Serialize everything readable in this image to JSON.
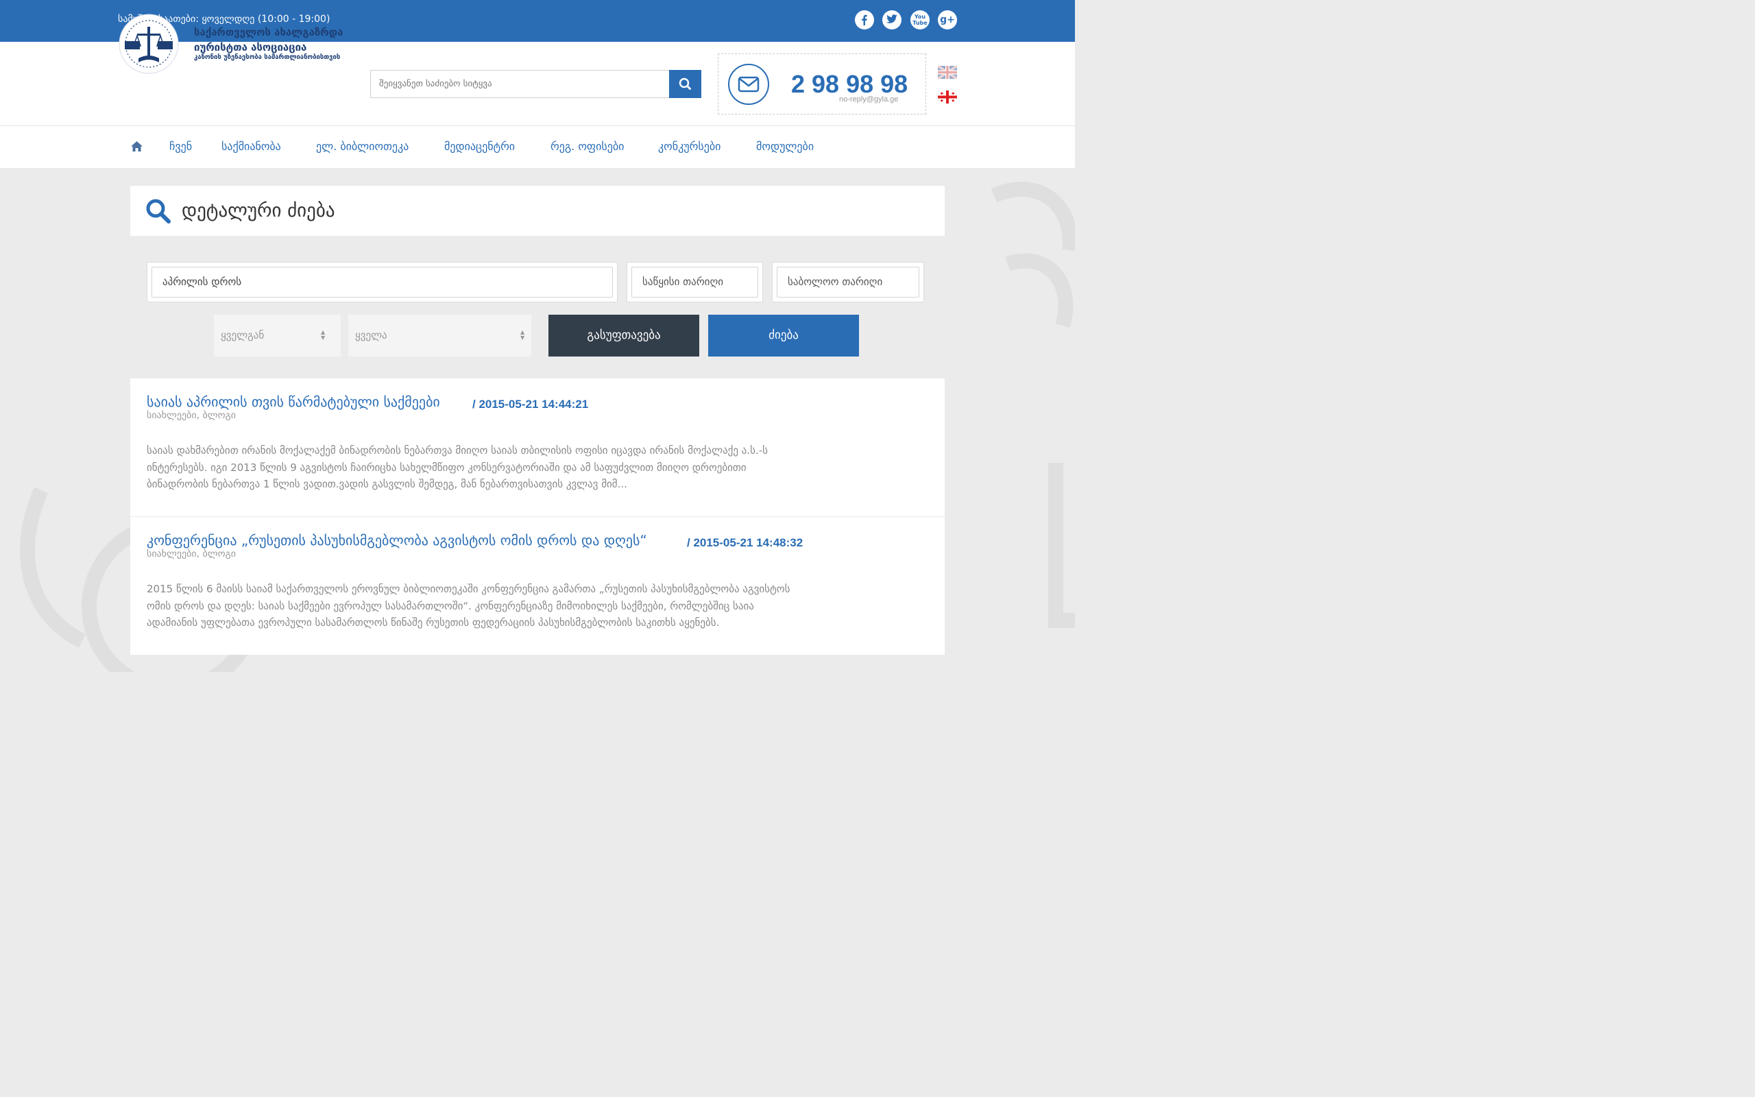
{
  "topbar": {
    "hours": "სამუშაო საათები: ყოველდღე (10:00 - 19:00)",
    "social": [
      {
        "name": "facebook-icon",
        "glyph": "f"
      },
      {
        "name": "twitter-icon",
        "glyph": ""
      },
      {
        "name": "youtube-icon",
        "glyph": "You"
      },
      {
        "name": "google-plus-icon",
        "glyph": "g+"
      }
    ]
  },
  "header": {
    "org_name_line1": "საქართველოს ახალგაზრდა",
    "org_name_line2": "იურისტთა ასოციაცია",
    "org_tagline": "კანონის უზენაესობა სამართლიანობისთვის",
    "search_placeholder": "შეიყვანეთ საძიებო სიტყვა",
    "phone": "2 98 98 98",
    "email": "no-reply@gyla.ge"
  },
  "nav": {
    "items": [
      "ჩვენ",
      "საქმიანობა",
      "ელ. ბიბლიოთეკა",
      "მედიაცენტრი",
      "რეგ. ოფისები",
      "კონკურსები",
      "მოდულები"
    ]
  },
  "search": {
    "title": "დეტალური ძიება",
    "query_value": "აპრილის დროს",
    "start_date_placeholder": "საწყისი თარიღი",
    "end_date_placeholder": "საბოლოო თარიღი",
    "source_select": "ყველგან",
    "category_select": "ყველა",
    "clear_button": "გასუფთავება",
    "search_button": "ძიება"
  },
  "results": [
    {
      "title": "საიას აპრილის თვის წარმატებული საქმეები",
      "date": "/ 2015-05-21 14:44:21",
      "categories": "სიახლეები, ბლოგი",
      "lines": [
        "საიას დახმარებით ირანის მოქალაქემ ბინადრობის ნებართვა მიიღო საიას თბილისის ოფისი იცავდა ირანის მოქალაქე ა.ს.-ს",
        "ინტერესებს. იგი 2013 წლის 9 აგვისტოს ჩაირიცხა სახელმწიფო კონსერვატორიაში  და ამ საფუძვლით მიიღო დროებითი",
        "ბინადრობის ნებართვა 1 წლის ვადით.ვადის გასვლის შემდეგ,  მან  ნებართვისათვის  კვლავ მიმ..."
      ]
    },
    {
      "title": "კონფერენცია „რუსეთის პასუხისმგებლობა აგვისტოს ომის დროს და დღეს“",
      "date": "/ 2015-05-21 14:48:32",
      "categories": "სიახლეები, ბლოგი",
      "lines": [
        "2015 წლის 6 მაისს საიამ საქართველოს ეროვნულ ბიბლიოთეკაში კონფერენცია გამართა „რუსეთის პასუხისმგებლობა აგვისტოს",
        "ომის დროს და დღეს: საიას საქმეები ევროპულ სასამართლოში“. კონფერენციაზე მიმოიხილეს საქმეები, რომლებშიც საია",
        "ადამიანის უფლებათა ევროპული სასამართლოს წინაშე  რუსეთის ფედერაციის პასუხისმგებლობის საკითხს აყენებს."
      ]
    }
  ],
  "colors": {
    "primary": "#2a6db5",
    "dark_button": "#333e4b",
    "background": "#ebebeb"
  }
}
